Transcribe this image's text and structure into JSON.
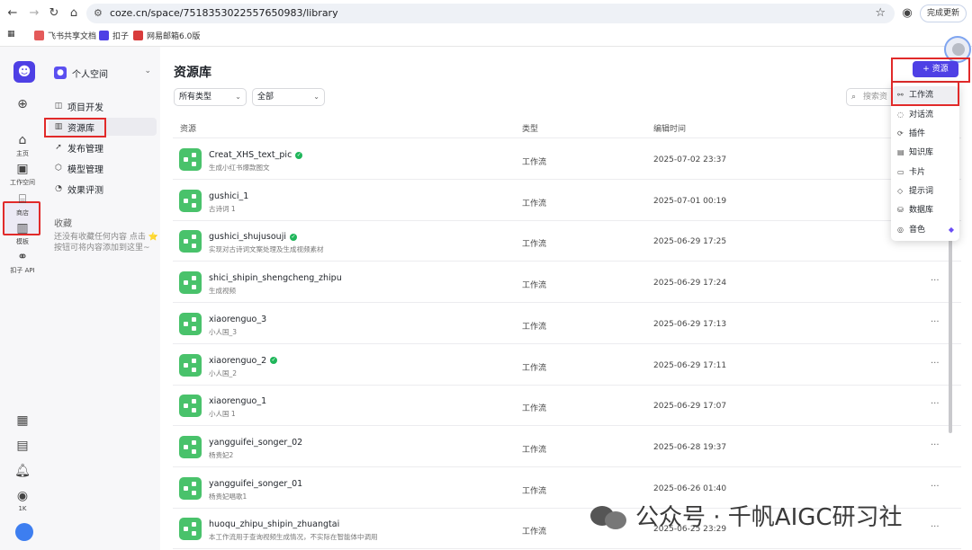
{
  "browser": {
    "url": "coze.cn/space/7518353022557650983/library",
    "update_label": "完成更新",
    "bookmarks": [
      "飞书共享文档",
      "扣子",
      "网易邮箱6.0版"
    ]
  },
  "rail": {
    "items": [
      {
        "label": "主页"
      },
      {
        "label": "工作空间"
      },
      {
        "label": "商店"
      },
      {
        "label": "模板"
      },
      {
        "label": "扣子 API"
      }
    ],
    "count_label": "1K"
  },
  "sidebar": {
    "workspace": "个人空间",
    "items": [
      {
        "label": "项目开发"
      },
      {
        "label": "资源库"
      },
      {
        "label": "发布管理"
      },
      {
        "label": "模型管理"
      },
      {
        "label": "效果评测"
      }
    ],
    "favorites_title": "收藏",
    "favorites_empty": "还没有收藏任何内容 点击 ⭐ 按钮可将内容添加到这里~"
  },
  "main": {
    "title": "资源库",
    "filter_type": "所有类型",
    "filter_scope": "全部",
    "search_placeholder": "搜索资",
    "columns": [
      "资源",
      "类型",
      "编辑时间"
    ],
    "rows": [
      {
        "name": "Creat_XHS_text_pic",
        "desc": "生成小红书爆款图文",
        "type": "工作流",
        "time": "2025-07-02 23:37",
        "verified": true
      },
      {
        "name": "gushici_1",
        "desc": "古诗词 1",
        "type": "工作流",
        "time": "2025-07-01 00:19",
        "verified": false
      },
      {
        "name": "gushici_shujusouji",
        "desc": "实现对古诗词文案处理及生成视频素材",
        "type": "工作流",
        "time": "2025-06-29 17:25",
        "verified": true
      },
      {
        "name": "shici_shipin_shengcheng_zhipu",
        "desc": "生成视频",
        "type": "工作流",
        "time": "2025-06-29 17:24",
        "verified": false
      },
      {
        "name": "xiaorenguo_3",
        "desc": "小人国_3",
        "type": "工作流",
        "time": "2025-06-29 17:13",
        "verified": false
      },
      {
        "name": "xiaorenguo_2",
        "desc": "小人国_2",
        "type": "工作流",
        "time": "2025-06-29 17:11",
        "verified": true
      },
      {
        "name": "xiaorenguo_1",
        "desc": "小人国 1",
        "type": "工作流",
        "time": "2025-06-29 17:07",
        "verified": false
      },
      {
        "name": "yangguifei_songer_02",
        "desc": "杨贵妃2",
        "type": "工作流",
        "time": "2025-06-28 19:37",
        "verified": false
      },
      {
        "name": "yangguifei_songer_01",
        "desc": "杨贵妃唱歌1",
        "type": "工作流",
        "time": "2025-06-26 01:40",
        "verified": false
      },
      {
        "name": "huoqu_zhipu_shipin_zhuangtai",
        "desc": "本工作流用于查询视频生成情况，不实际在智能体中调用",
        "type": "工作流",
        "time": "2025-06-25 23:29",
        "verified": false
      }
    ],
    "more": "···"
  },
  "dropdown": {
    "add_label": "+ 资源",
    "items": [
      "工作流",
      "对话流",
      "插件",
      "知识库",
      "卡片",
      "提示词",
      "数据库",
      "音色"
    ]
  },
  "watermark": "公众号 · 千帆AIGC研习社",
  "colors": {
    "accent": "#4e40e5",
    "workflow_icon": "#49c26b",
    "highlight_border": "#e12a2a"
  }
}
